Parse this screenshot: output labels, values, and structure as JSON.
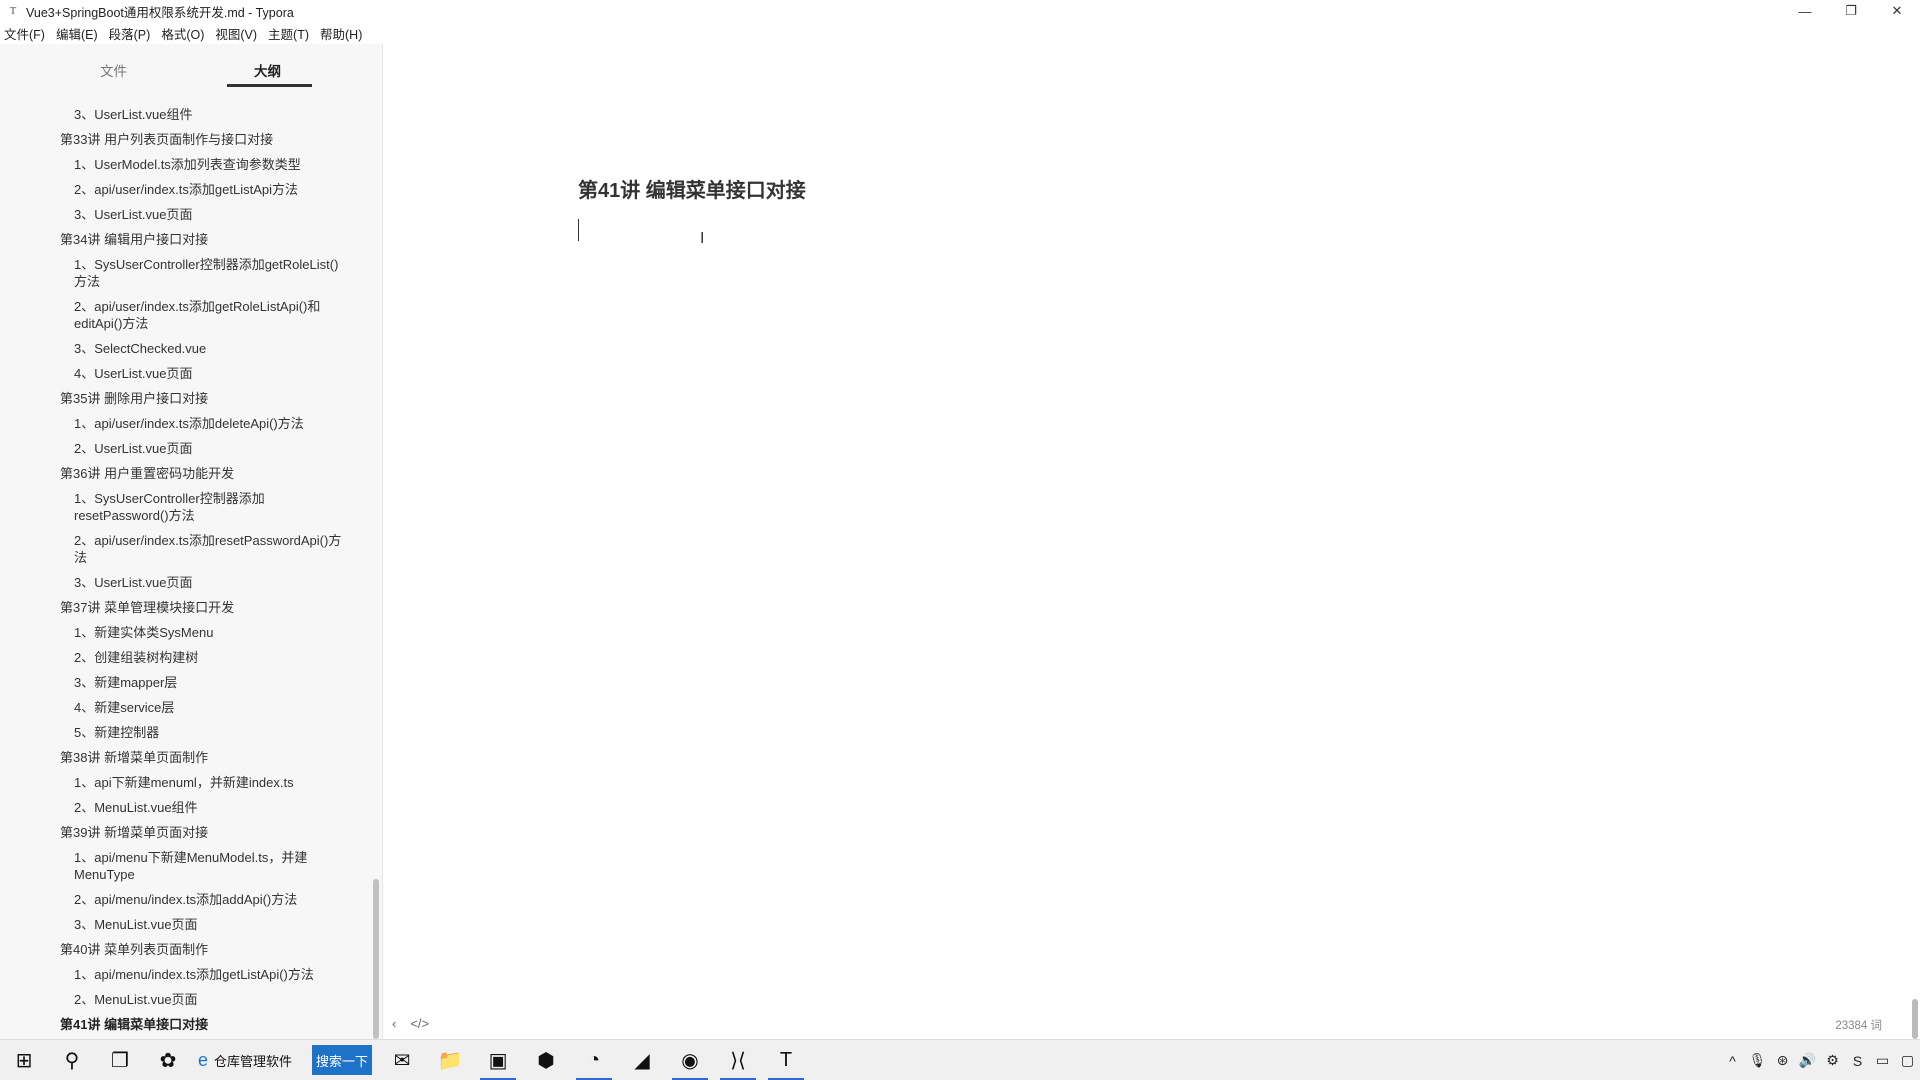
{
  "window": {
    "title": "Vue3+SpringBoot通用权限系统开发.md - Typora",
    "app_icon": "T",
    "minimize": "—",
    "maximize": "❐",
    "close": "✕"
  },
  "menubar": [
    "文件(F)",
    "编辑(E)",
    "段落(P)",
    "格式(O)",
    "视图(V)",
    "主题(T)",
    "帮助(H)"
  ],
  "sidebar": {
    "tabs": {
      "file": "文件",
      "outline": "大纲"
    },
    "outline": [
      {
        "level": 3,
        "text": "3、UserList.vue组件"
      },
      {
        "level": 2,
        "text": "第33讲 用户列表页面制作与接口对接"
      },
      {
        "level": 3,
        "text": "1、UserModel.ts添加列表查询参数类型"
      },
      {
        "level": 3,
        "text": "2、api/user/index.ts添加getListApi方法"
      },
      {
        "level": 3,
        "text": "3、UserList.vue页面"
      },
      {
        "level": 2,
        "text": "第34讲 编辑用户接口对接"
      },
      {
        "level": 3,
        "text": "1、SysUserController控制器添加getRoleList()方法"
      },
      {
        "level": 3,
        "text": "2、api/user/index.ts添加getRoleListApi()和editApi()方法"
      },
      {
        "level": 3,
        "text": "3、SelectChecked.vue"
      },
      {
        "level": 3,
        "text": "4、UserList.vue页面"
      },
      {
        "level": 2,
        "text": "第35讲 删除用户接口对接"
      },
      {
        "level": 3,
        "text": "1、api/user/index.ts添加deleteApi()方法"
      },
      {
        "level": 3,
        "text": "2、UserList.vue页面"
      },
      {
        "level": 2,
        "text": "第36讲 用户重置密码功能开发"
      },
      {
        "level": 3,
        "text": "1、SysUserController控制器添加resetPassword()方法"
      },
      {
        "level": 3,
        "text": "2、api/user/index.ts添加resetPasswordApi()方法"
      },
      {
        "level": 3,
        "text": "3、UserList.vue页面"
      },
      {
        "level": 2,
        "text": "第37讲 菜单管理模块接口开发"
      },
      {
        "level": 3,
        "text": "1、新建实体类SysMenu"
      },
      {
        "level": 3,
        "text": "2、创建组装树构建树"
      },
      {
        "level": 3,
        "text": "3、新建mapper层"
      },
      {
        "level": 3,
        "text": "4、新建service层"
      },
      {
        "level": 3,
        "text": "5、新建控制器"
      },
      {
        "level": 2,
        "text": "第38讲 新增菜单页面制作"
      },
      {
        "level": 3,
        "text": "1、api下新建menuml，并新建index.ts"
      },
      {
        "level": 3,
        "text": "2、MenuList.vue组件"
      },
      {
        "level": 2,
        "text": "第39讲 新增菜单页面对接"
      },
      {
        "level": 3,
        "text": "1、api/menu下新建MenuModel.ts，并建MenuType"
      },
      {
        "level": 3,
        "text": "2、api/menu/index.ts添加addApi()方法"
      },
      {
        "level": 3,
        "text": "3、MenuList.vue页面"
      },
      {
        "level": 2,
        "text": "第40讲 菜单列表页面制作"
      },
      {
        "level": 3,
        "text": "1、api/menu/index.ts添加getListApi()方法"
      },
      {
        "level": 3,
        "text": "2、MenuList.vue页面"
      },
      {
        "level": 2,
        "text": "第41讲 编辑菜单接口对接",
        "active": true
      }
    ]
  },
  "editor": {
    "heading": "第41讲 编辑菜单接口对接",
    "footer_left": [
      "‹",
      "</>"
    ],
    "word_count": "23384 词"
  },
  "taskbar": {
    "start_icon": "⊞",
    "search_icon": "⚲",
    "taskview_icon": "❐",
    "app1_icon": "✿",
    "app_label": "仓库管理软件",
    "search_button": "搜索一下",
    "pinned": [
      "✉",
      "📁",
      "▣",
      "⬢",
      "◔",
      "◢",
      "◉",
      "⟩⟨",
      "T"
    ],
    "tray": [
      "^",
      "🎙",
      "⊛",
      "🔊",
      "⚙",
      "S",
      "▭",
      "▢"
    ]
  },
  "colors": {
    "sidebar_bg": "#f7f7f7",
    "accent": "#2b6cd4",
    "search_button_bg": "#1e73c9"
  }
}
